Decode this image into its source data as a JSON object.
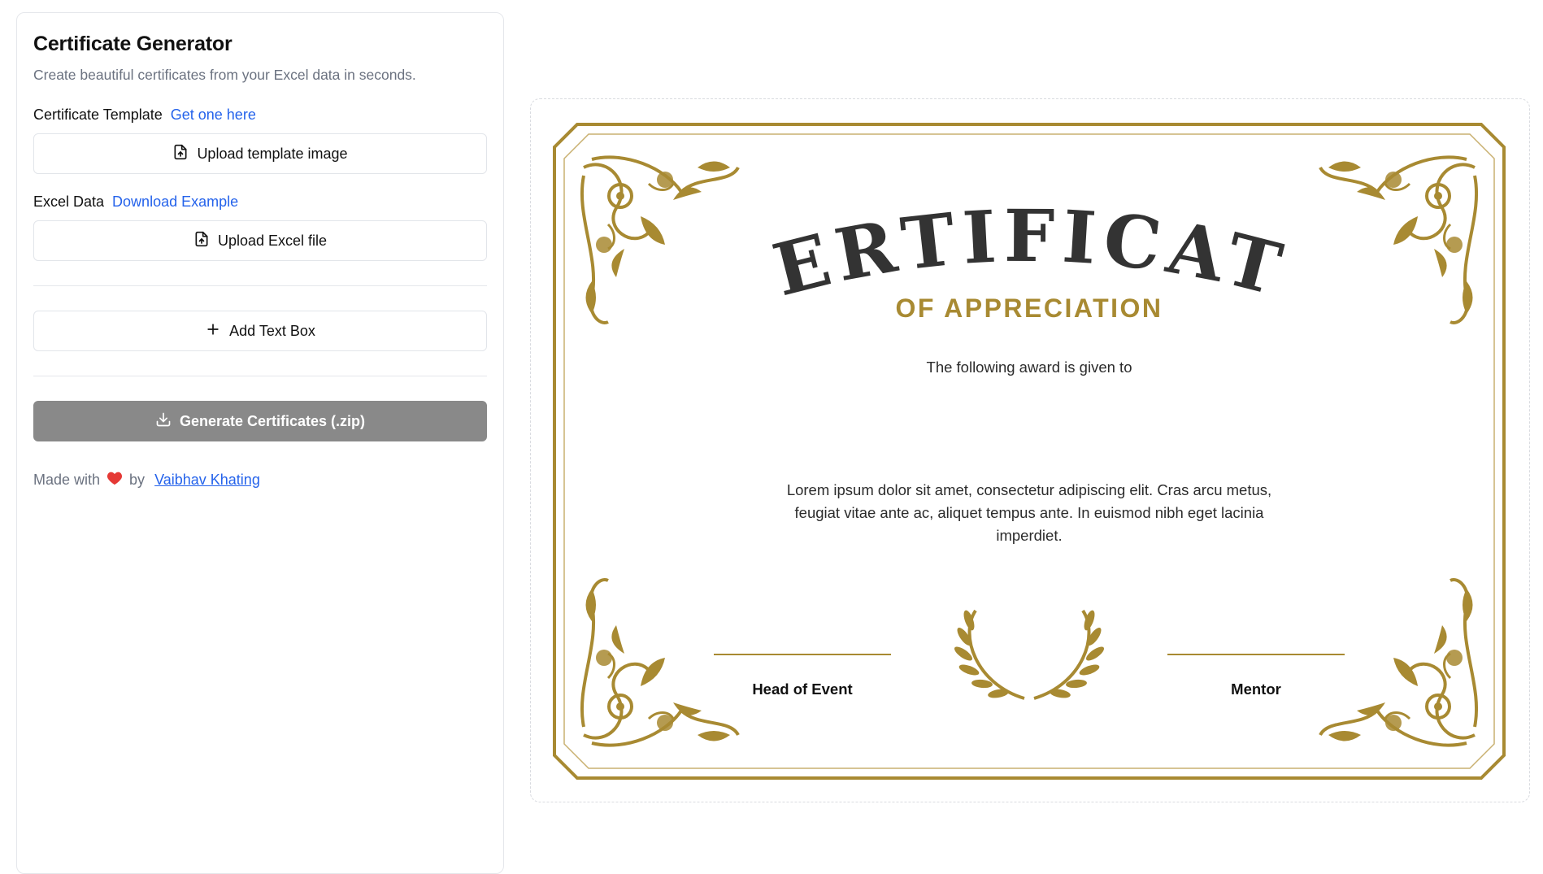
{
  "sidebar": {
    "title": "Certificate Generator",
    "subtitle": "Create beautiful certificates from your Excel data in seconds.",
    "template": {
      "label": "Certificate Template",
      "link": "Get one here",
      "upload_button": "Upload template image"
    },
    "excel": {
      "label": "Excel Data",
      "link": "Download Example",
      "upload_button": "Upload Excel file"
    },
    "add_text_box_button": "Add Text Box",
    "generate_button": "Generate Certificates (.zip)",
    "footer": {
      "made_with": "Made with",
      "by": "by",
      "author": "Vaibhav Khating"
    }
  },
  "certificate": {
    "title": "CERTIFICATE",
    "subtitle": "OF APPRECIATION",
    "given_to": "The following award is given to",
    "body": "Lorem ipsum dolor sit amet, consectetur adipiscing elit. Cras arcu metus, feugiat vitae ante ac, aliquet tempus ante. In euismod nibh eget lacinia imperdiet.",
    "signature_left": "Head of Event",
    "signature_right": "Mentor"
  },
  "colors": {
    "accent": "#2563eb",
    "gold": "#a88a32",
    "disabled_button": "#898989",
    "heart": "#e53935"
  },
  "icons": {
    "upload": "file-upload-icon",
    "plus": "plus-icon",
    "download": "download-icon",
    "heart": "heart-icon"
  }
}
